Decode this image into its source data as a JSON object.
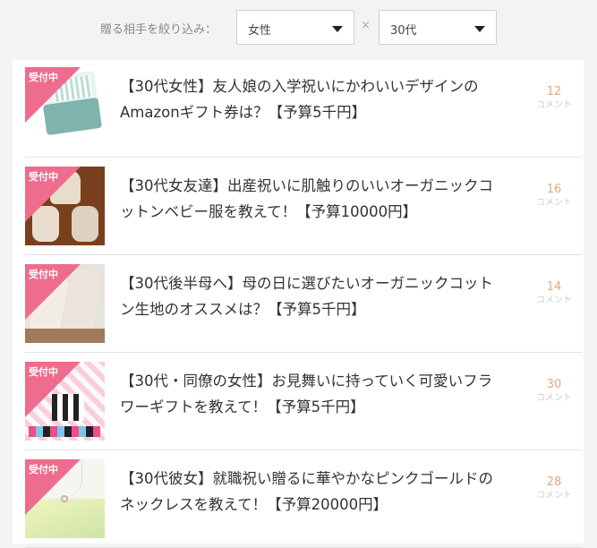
{
  "filter": {
    "label": "贈る相手を絞り込み：",
    "gender": "女性",
    "separator": "×",
    "age": "30代"
  },
  "badge_text": "受付中",
  "comment_label": "コメント",
  "items": [
    {
      "title": "【30代女性】友人娘の入学祝いにかわいいデザインのAmazonギフト券は？【予算5千円】",
      "comments": "12"
    },
    {
      "title": "【30代女友達】出産祝いに肌触りのいいオーガニックコットンベビー服を教えて！【予算10000円】",
      "comments": "16"
    },
    {
      "title": "【30代後半母へ】母の日に選びたいオーガニックコットン生地のオススメは？【予算5千円】",
      "comments": "14"
    },
    {
      "title": "【30代・同僚の女性】お見舞いに持っていく可愛いフラワーギフトを教えて！【予算5千円】",
      "comments": "30"
    },
    {
      "title": "【30代彼女】就職祝い贈るに華やかなピンクゴールドのネックレスを教えて！【予算20000円】",
      "comments": "28"
    }
  ]
}
